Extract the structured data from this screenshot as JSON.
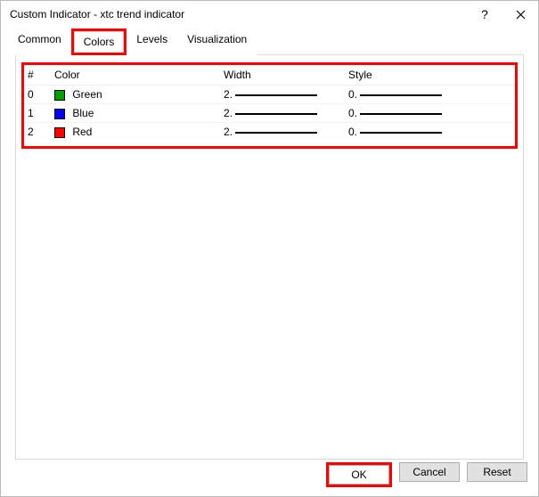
{
  "window": {
    "title": "Custom Indicator - xtc trend indicator"
  },
  "tabs": [
    "Common",
    "Colors",
    "Levels",
    "Visualization"
  ],
  "active_tab": 1,
  "table": {
    "columns": {
      "c0": "#",
      "c1": "Color",
      "c2": "Width",
      "c3": "Style"
    },
    "rows": [
      {
        "idx": "0",
        "color_name": "Green",
        "color_hex": "#00A000",
        "width": "2.",
        "style": "0."
      },
      {
        "idx": "1",
        "color_name": "Blue",
        "color_hex": "#0000FF",
        "width": "2.",
        "style": "0."
      },
      {
        "idx": "2",
        "color_name": "Red",
        "color_hex": "#FF0000",
        "width": "2.",
        "style": "0."
      }
    ]
  },
  "buttons": {
    "ok": "OK",
    "cancel": "Cancel",
    "reset": "Reset"
  }
}
